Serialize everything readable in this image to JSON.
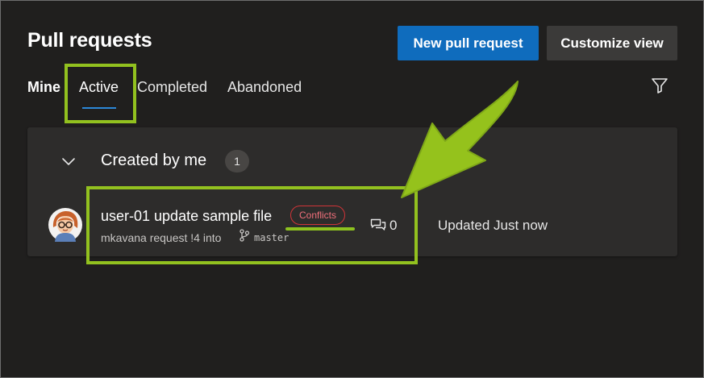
{
  "header": {
    "title": "Pull requests",
    "new_pr_label": "New pull request",
    "customize_label": "Customize view"
  },
  "pivots": {
    "mine": "Mine",
    "active": "Active",
    "completed": "Completed",
    "abandoned": "Abandoned"
  },
  "group": {
    "title": "Created by me",
    "count": "1"
  },
  "pull_request": {
    "title": "user-01 update sample file",
    "status_badge": "Conflicts",
    "subtitle": "mkavana request !4 into",
    "branch": "master",
    "comments": "0",
    "updated": "Updated Just now"
  },
  "icons": {
    "filter": "filter-icon",
    "chevron": "chevron-down-icon",
    "avatar": "avatar",
    "branch": "branch-icon",
    "comment": "comment-icon"
  },
  "colors": {
    "background": "#201f1e",
    "card": "#2d2c2b",
    "primary_button": "#0f6cbd",
    "secondary_button": "#3b3a39",
    "tab_underline": "#2b88d8",
    "conflict": "#d13438",
    "annotation": "#92c11f"
  }
}
